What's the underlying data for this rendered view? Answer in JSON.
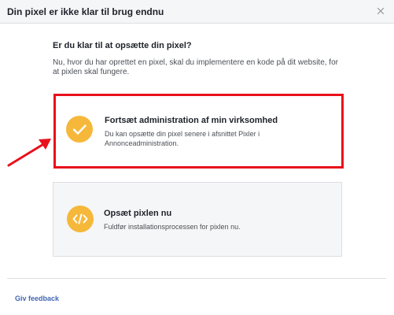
{
  "dialog": {
    "title": "Din pixel er ikke klar til brug endnu",
    "close_icon": "close-icon"
  },
  "content": {
    "question": "Er du klar til at opsætte din pixel?",
    "description": "Nu, hvor du har oprettet en pixel, skal du implementere en kode på dit website, for at pixlen skal fungere."
  },
  "options": [
    {
      "icon": "checkmark-icon",
      "title": "Fortsæt administration af min virksomhed",
      "description": "Du kan opsætte din pixel senere i afsnittet Pixler i Annonceadministration.",
      "highlighted": true
    },
    {
      "icon": "code-icon",
      "title": "Opsæt pixlen nu",
      "description": "Fuldfør installationsprocessen for pixlen nu.",
      "highlighted": false
    }
  ],
  "annotation": {
    "arrow_icon": "red-arrow-icon",
    "highlight_color": "#e8101a"
  },
  "footer": {
    "feedback_label": "Giv feedback"
  },
  "colors": {
    "accent": "#f6b83a",
    "link": "#4267b2",
    "header_bg": "#f5f6f7"
  }
}
